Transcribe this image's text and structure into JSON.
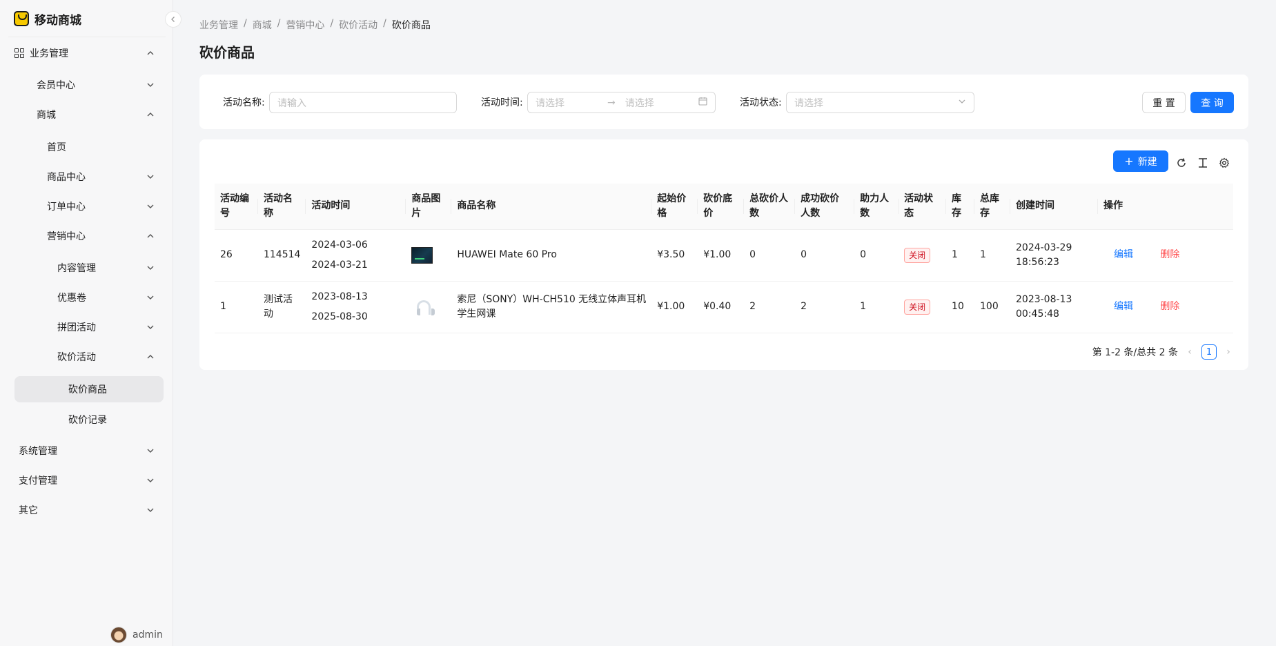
{
  "app": {
    "name": "移动商城"
  },
  "sidebar": {
    "groups": [
      {
        "label": "业务管理",
        "expanded": true
      },
      {
        "label": "会员中心"
      },
      {
        "label": "商城",
        "expanded": true
      },
      {
        "label": "首页"
      },
      {
        "label": "商品中心"
      },
      {
        "label": "订单中心"
      },
      {
        "label": "营销中心",
        "expanded": true
      },
      {
        "label": "内容管理"
      },
      {
        "label": "优惠卷"
      },
      {
        "label": "拼团活动"
      },
      {
        "label": "砍价活动",
        "expanded": true
      },
      {
        "label": "砍价商品",
        "active": true
      },
      {
        "label": "砍价记录"
      },
      {
        "label": "系统管理"
      },
      {
        "label": "支付管理"
      },
      {
        "label": "其它"
      }
    ],
    "user": "admin"
  },
  "breadcrumb": [
    "业务管理",
    "商城",
    "营销中心",
    "砍价活动",
    "砍价商品"
  ],
  "breadcrumb_sep": "/",
  "page_title": "砍价商品",
  "search": {
    "name_label": "活动名称:",
    "name_placeholder": "请输入",
    "time_label": "活动时间:",
    "time_start_placeholder": "请选择",
    "time_end_placeholder": "请选择",
    "status_label": "活动状态:",
    "status_placeholder": "请选择",
    "reset_label": "重 置",
    "query_label": "查 询"
  },
  "toolbar": {
    "new_label": "新建"
  },
  "table": {
    "headers": [
      "活动编号",
      "活动名称",
      "活动时间",
      "商品图片",
      "商品名称",
      "起始价格",
      "砍价底价",
      "总砍价人数",
      "成功砍价人数",
      "助力人数",
      "活动状态",
      "库存",
      "总库存",
      "创建时间",
      "操作"
    ],
    "rows": [
      {
        "id": "26",
        "name": "114514",
        "start": "2024-03-06",
        "end": "2024-03-21",
        "product": "HUAWEI Mate 60 Pro",
        "start_price": "¥3.50",
        "floor_price": "¥1.00",
        "total_bargain": "0",
        "success_bargain": "0",
        "helpers": "0",
        "status": "关闭",
        "stock": "1",
        "total_stock": "1",
        "created_date": "2024-03-29",
        "created_time": "18:56:23",
        "edit": "编辑",
        "delete": "删除"
      },
      {
        "id": "1",
        "name": "测试活动",
        "start": "2023-08-13",
        "end": "2025-08-30",
        "product": "索尼（SONY）WH-CH510 无线立体声耳机 学生网课",
        "start_price": "¥1.00",
        "floor_price": "¥0.40",
        "total_bargain": "2",
        "success_bargain": "2",
        "helpers": "1",
        "status": "关闭",
        "stock": "10",
        "total_stock": "100",
        "created_date": "2023-08-13",
        "created_time": "00:45:48",
        "edit": "编辑",
        "delete": "删除"
      }
    ]
  },
  "pagination": {
    "summary": "第 1-2 条/总共 2 条",
    "current": "1"
  },
  "colors": {
    "primary": "#1677ff",
    "danger": "#ff4d4f",
    "tag_red": "#cf1322"
  }
}
